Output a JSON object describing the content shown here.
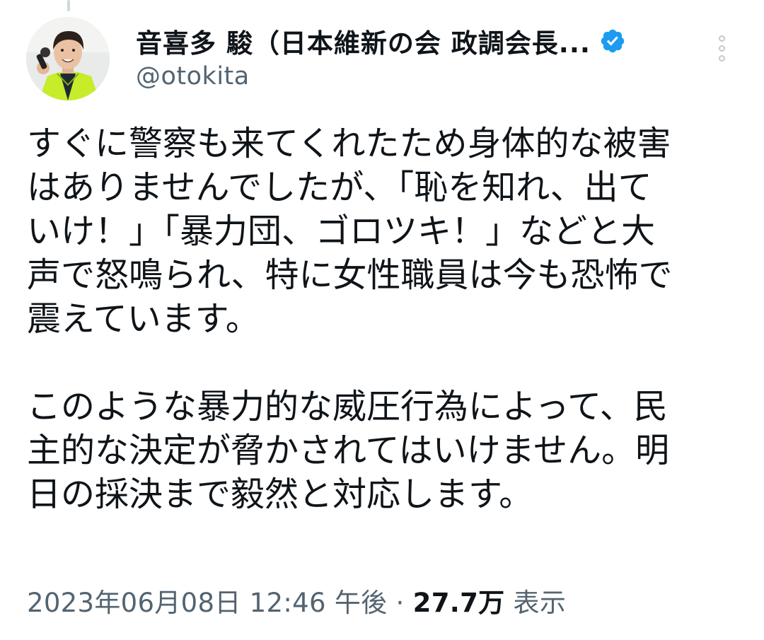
{
  "author": {
    "display_name": "音喜多 駿（日本維新の会 政調会長...",
    "handle": "@otokita",
    "verified_icon": "verified-badge-icon",
    "verified_color": "#1d9bf0"
  },
  "menu": {
    "icon": "more-vertical-icon"
  },
  "tweet": {
    "paragraph1": "すぐに警察も来てくれたため身体的な被害\nはありませんでしたが、「恥を知れ、出て\nいけ！」「暴力団、ゴロツキ！」などと大\n声で怒鳴られ、特に女性職員は今も恐怖で\n震えています。",
    "paragraph2": "このような暴力的な威圧行為によって、民\n主的な決定が脅かされてはいけません。明\n日の採決まで毅然と対応します。"
  },
  "meta": {
    "timestamp": "2023年06月08日 12:46 午後",
    "separator": "·",
    "views_count": "27.7万",
    "views_label": "表示"
  },
  "colors": {
    "text_primary": "#0f1419",
    "text_secondary": "#536471",
    "accent": "#1d9bf0"
  }
}
